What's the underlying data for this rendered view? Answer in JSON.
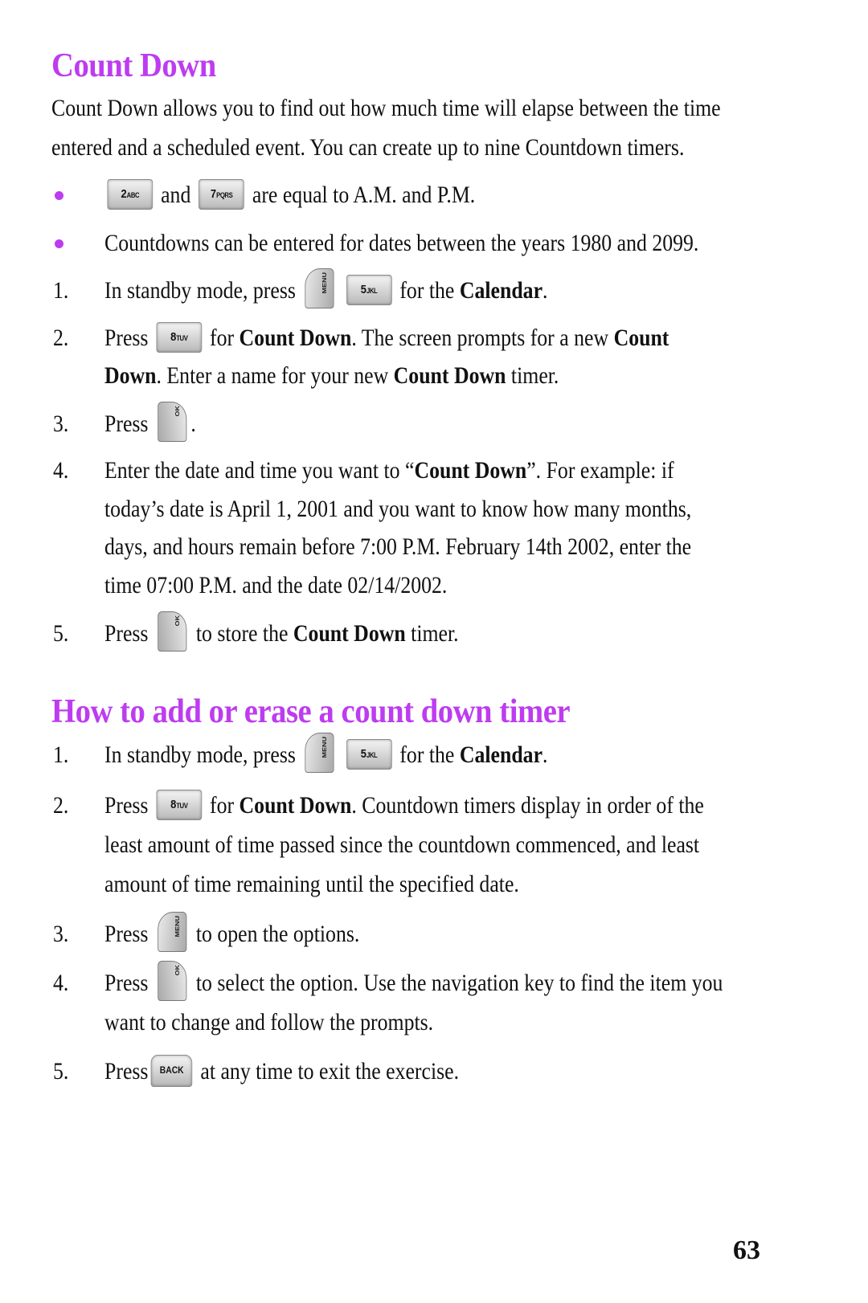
{
  "section1": {
    "heading": "Count Down",
    "intro_lines": [
      "Count Down allows you to find out how much time will elapse between the time",
      "entered and a scheduled event. You can create up to nine Countdown timers."
    ],
    "bullets": {
      "b1_and": "and",
      "b1_rest": "are equal to A.M. and P.M.",
      "b2": "Countdowns can be entered for dates between the years 1980 and 2099."
    },
    "steps": {
      "s1": {
        "num": "1.",
        "pre": "In standby mode, press",
        "mid": "for the",
        "bold": "Calendar",
        "post": "."
      },
      "s2": {
        "num": "2.",
        "pre": "Press",
        "for": "for",
        "bold1": "Count Down",
        "t1": ". The screen prompts for a new",
        "bold2": "Count",
        "line2_bold": "Down",
        "line2_t1": ". Enter a name for your new",
        "line2_bold2": "Count Down",
        "line2_t2": "timer."
      },
      "s3": {
        "num": "3.",
        "pre": "Press",
        "post": "."
      },
      "s4": {
        "num": "4.",
        "l1_pre": "Enter the date and time you want to “",
        "l1_bold": "Count Down",
        "l1_post": "”. For example: if",
        "l2": "today’s date is April 1, 2001 and you want to know how many months,",
        "l3": "days, and hours remain before 7:00 P.M. February 14th 2002, enter the",
        "l4": "time 07:00 P.M. and the date 02/14/2002."
      },
      "s5": {
        "num": "5.",
        "pre": "Press",
        "t1": "to store the",
        "bold": "Count Down",
        "post": "timer."
      }
    }
  },
  "section2": {
    "heading": "How to add or erase a count down timer",
    "steps": {
      "s1": {
        "num": "1.",
        "pre": "In standby mode, press",
        "mid": "for the",
        "bold": "Calendar",
        "post": "."
      },
      "s2": {
        "num": "2.",
        "pre": "Press",
        "for": "for",
        "bold": "Count Down",
        "t1": ". Countdown timers display in order of the",
        "l2": "least amount of time passed since the countdown commenced, and least",
        "l3": "amount of time remaining until the specified date."
      },
      "s3": {
        "num": "3.",
        "pre": "Press",
        "post": "to open the options."
      },
      "s4": {
        "num": "4.",
        "pre": "Press",
        "post": "to select the option. Use the navigation key to find the item you",
        "l2": "want to change and follow the prompts."
      },
      "s5": {
        "num": "5.",
        "pre": "Press",
        "post": "at any time to exit the exercise."
      }
    }
  },
  "keys": {
    "k2": "2",
    "k2_sub": "ABC",
    "k7": "7",
    "k7_sub": "PQRS",
    "k5": "5",
    "k5_sub": "JKL",
    "k8": "8",
    "k8_sub": "TUV",
    "menu": "MENU",
    "ok": "OK",
    "back": "BACK"
  },
  "page_number": "63",
  "colors": {
    "accent": "#bd3cf0",
    "text": "#111111"
  }
}
